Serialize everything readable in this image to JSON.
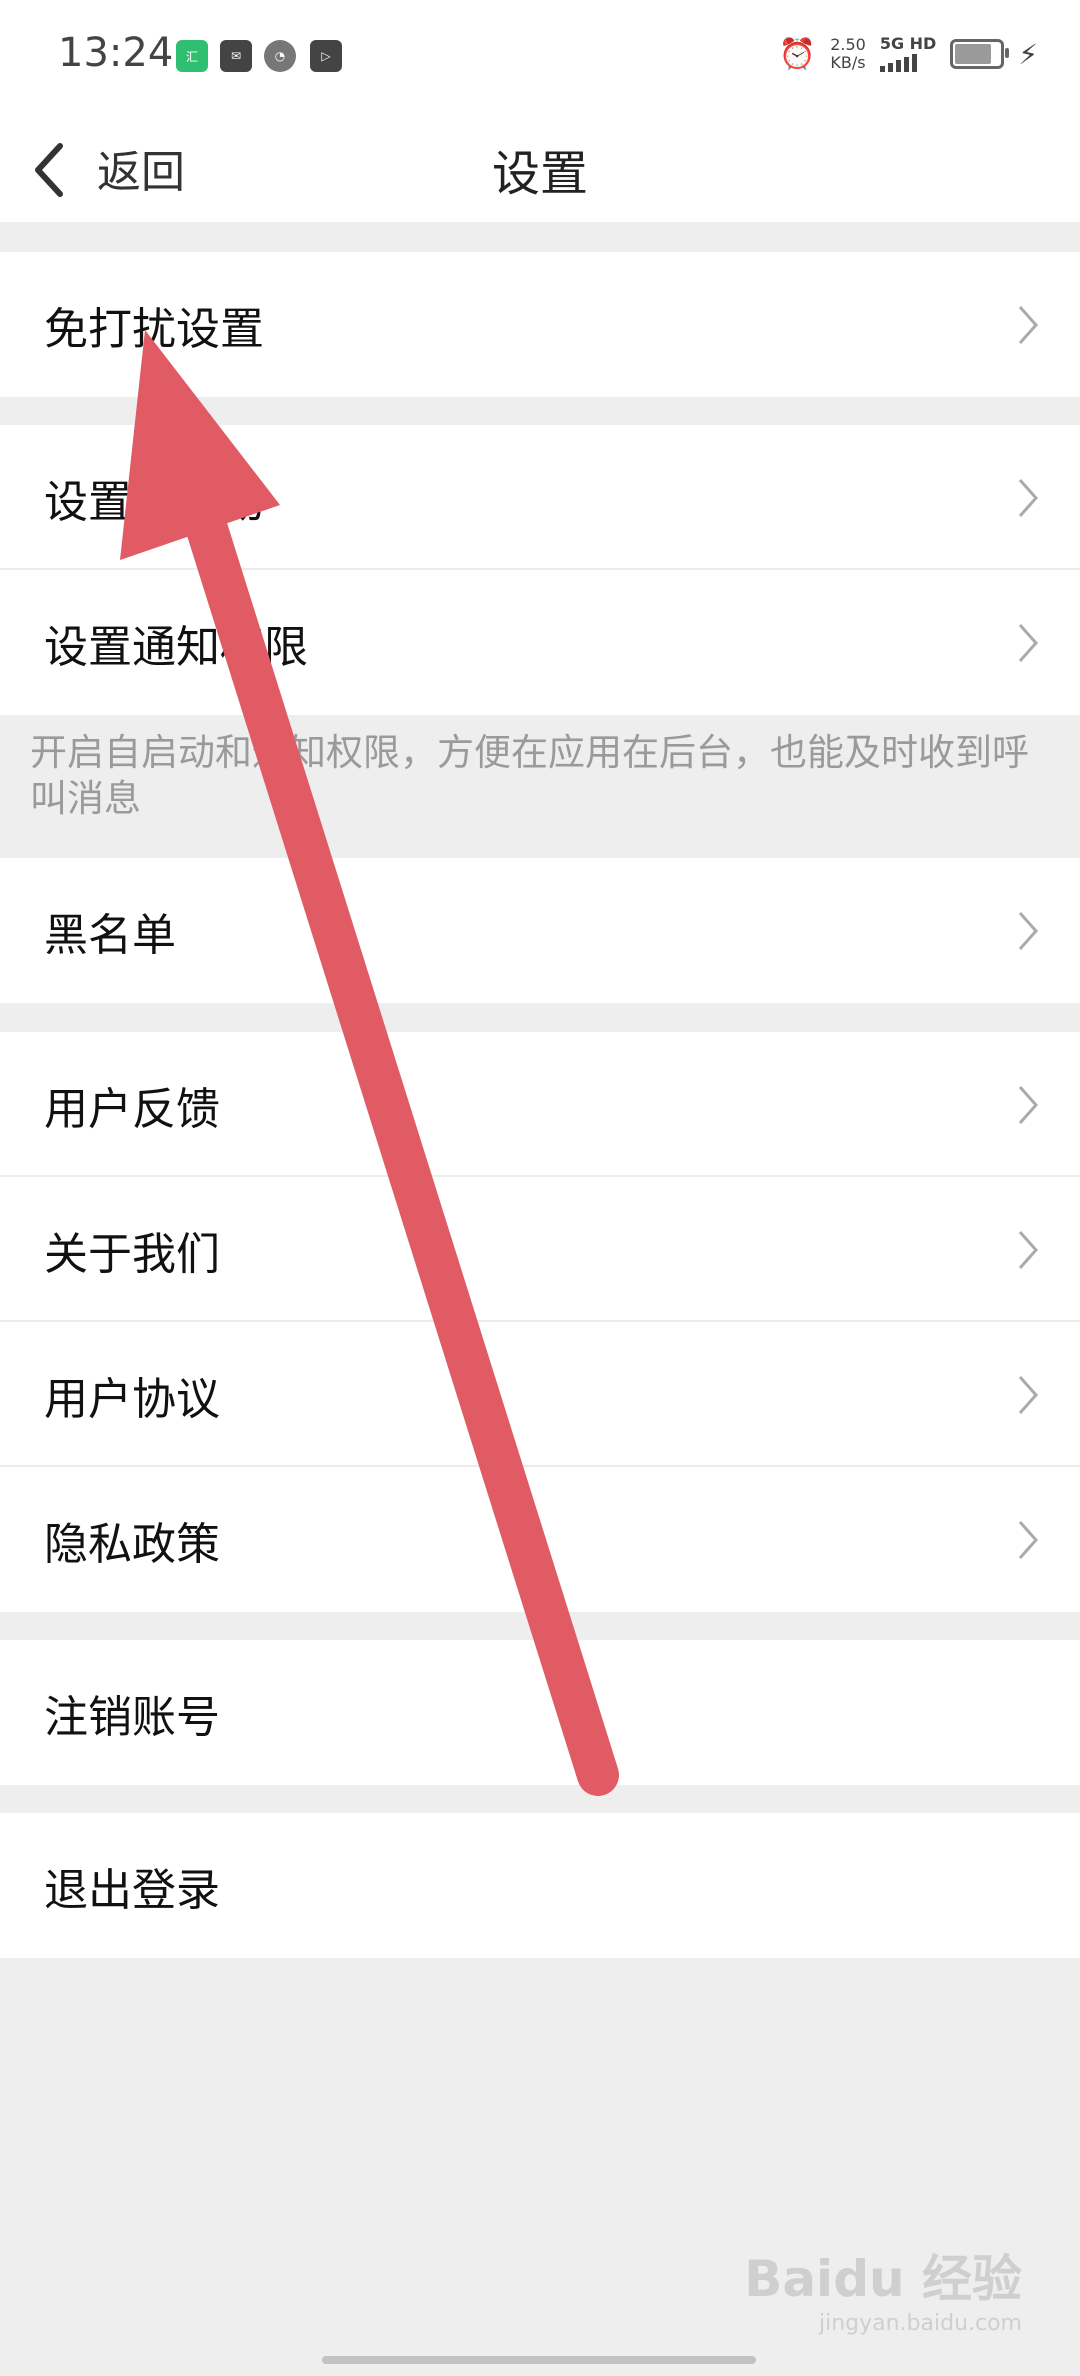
{
  "status_bar": {
    "time": "13:24",
    "speed_value": "2.50",
    "speed_unit": "KB/s",
    "network": "5G HD",
    "notif_icons": [
      "huitao-app-icon",
      "mail-app-icon",
      "browser-app-icon",
      "video-app-icon"
    ],
    "huitao_icon_text": "汇"
  },
  "nav": {
    "back_label": "返回",
    "title": "设置"
  },
  "rows": [
    {
      "label": "免打扰设置"
    },
    {
      "label": "设置自启动"
    },
    {
      "label": "设置通知权限"
    },
    {
      "label": "黑名单"
    },
    {
      "label": "用户反馈"
    },
    {
      "label": "关于我们"
    },
    {
      "label": "用户协议"
    },
    {
      "label": "隐私政策"
    },
    {
      "label": "注销账号"
    },
    {
      "label": "退出登录"
    }
  ],
  "hint": "开启自启动和通知权限，方便在应用在后台，也能及时收到呼叫消息",
  "watermark": {
    "brand": "Baidu 经验",
    "url": "jingyan.baidu.com"
  },
  "colors": {
    "background": "#eeeeee",
    "arrow": "#e05b63",
    "hint_text": "#9a9a9a"
  }
}
